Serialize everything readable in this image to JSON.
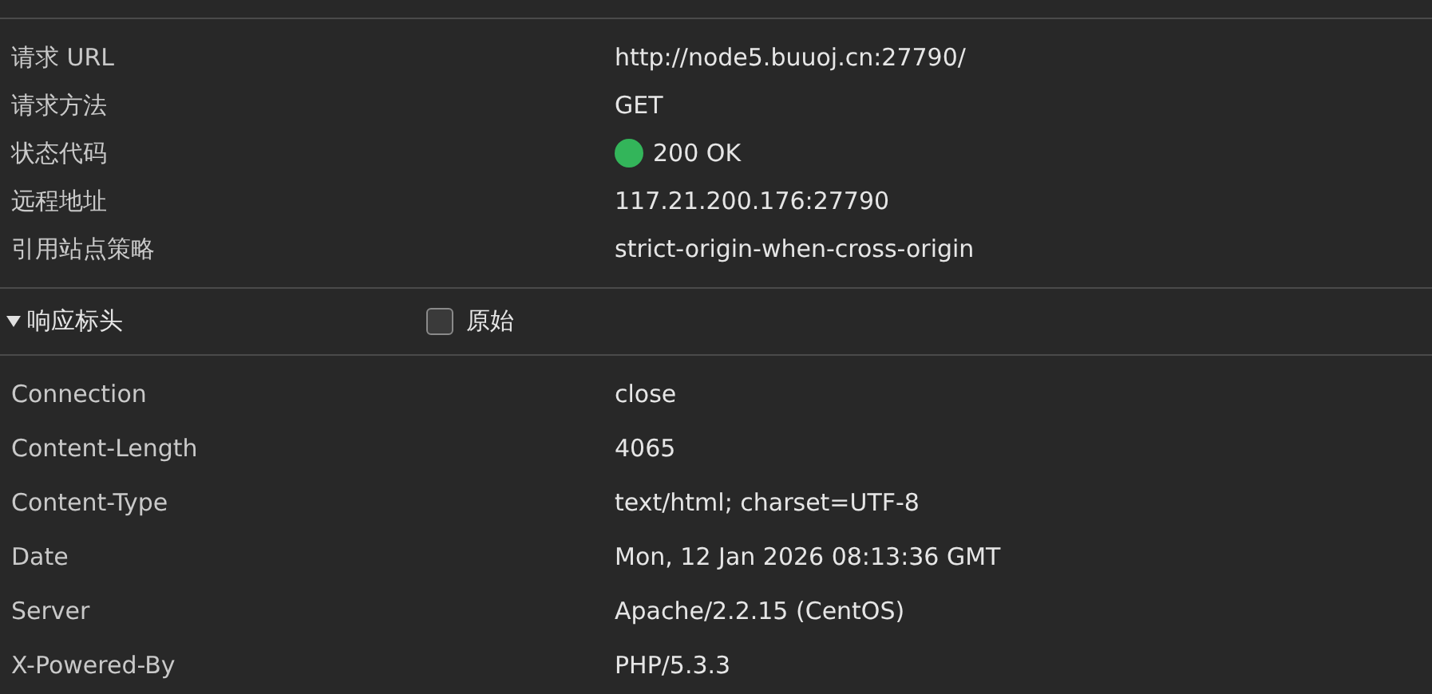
{
  "general": {
    "rows": [
      {
        "name": "请求 URL",
        "value": "http://node5.buuoj.cn:27790/"
      },
      {
        "name": "请求方法",
        "value": "GET"
      },
      {
        "name": "状态代码",
        "value": "200 OK",
        "color": "#33b55a"
      },
      {
        "name": "远程地址",
        "value": "117.21.200.176:27790"
      },
      {
        "name": "引用站点策略",
        "value": "strict-origin-when-cross-origin"
      }
    ]
  },
  "response_headers": {
    "title": "响应标头",
    "expanded": true,
    "raw": {
      "label": "原始",
      "checked": false
    },
    "rows": [
      {
        "name": "Connection",
        "value": "close"
      },
      {
        "name": "Content-Length",
        "value": "4065"
      },
      {
        "name": "Content-Type",
        "value": "text/html; charset=UTF-8"
      },
      {
        "name": "Date",
        "value": "Mon, 12 Jan 2026 08:13:36 GMT"
      },
      {
        "name": "Server",
        "value": "Apache/2.2.15 (CentOS)"
      },
      {
        "name": "X-Powered-By",
        "value": "PHP/5.3.3"
      }
    ]
  }
}
